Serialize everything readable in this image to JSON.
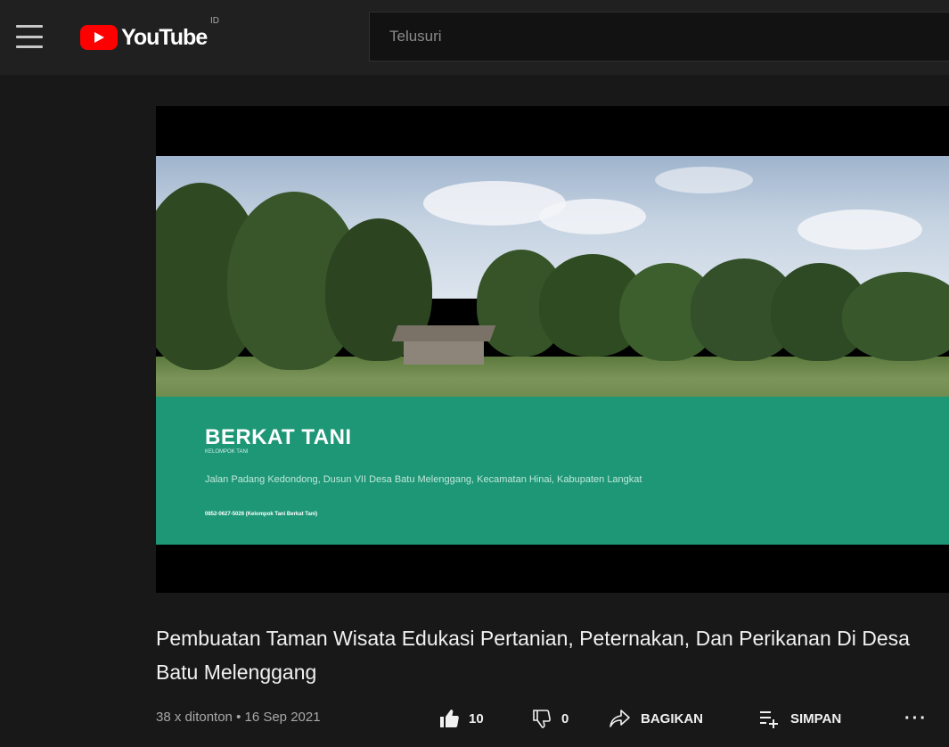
{
  "header": {
    "logo_text": "YouTube",
    "country_code": "ID",
    "search_placeholder": "Telusuri"
  },
  "video": {
    "slide_title": "BERKAT TANI",
    "slide_subtitle": "KELOMPOK TANI",
    "slide_address": "Jalan Padang Kedondong, Dusun VII Desa Batu Melenggang, Kecamatan Hinai, Kabupaten Langkat",
    "slide_phone": "0852-0627-5026 (Kelompok Tani Berkat Tani)",
    "title": "Pembuatan Taman Wisata Edukasi Pertanian, Peternakan, Dan Perikanan Di Desa Batu Melenggang",
    "views_date": "38 x ditonton • 16 Sep 2021",
    "likes": "10",
    "dislikes": "0",
    "share_label": "BAGIKAN",
    "save_label": "SIMPAN",
    "more_label": "···"
  },
  "colors": {
    "background": "#181818",
    "header": "#202020",
    "slide_green": "#1e9777",
    "logo_red": "#ff0000"
  },
  "icons": [
    "menu-icon",
    "youtube-logo-icon",
    "thumbs-up-icon",
    "thumbs-down-icon",
    "share-icon",
    "playlist-add-icon",
    "more-icon"
  ]
}
